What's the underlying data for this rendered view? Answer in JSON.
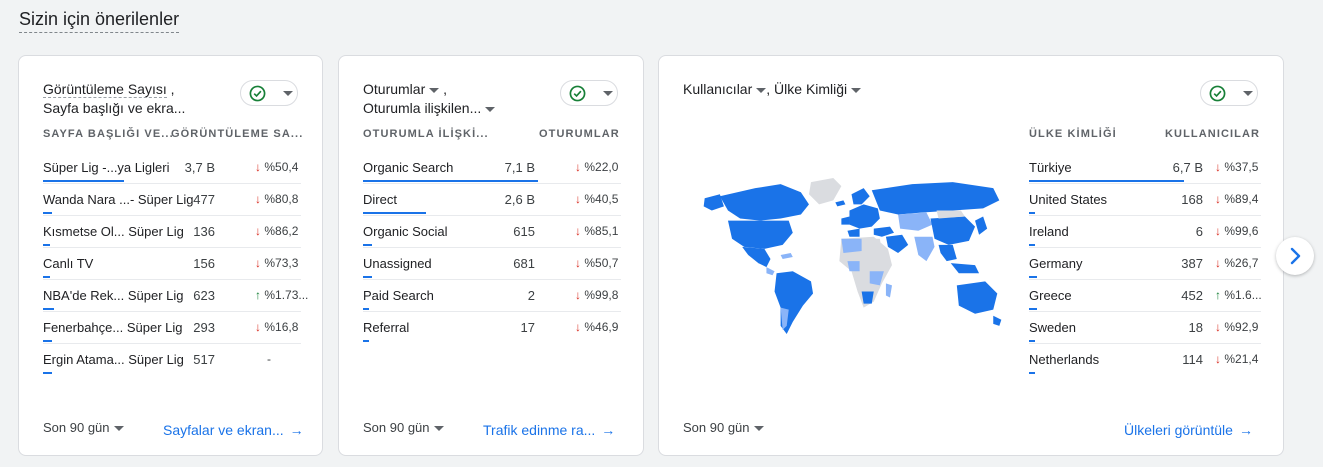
{
  "section_title": "Sizin için önerilenler",
  "colors": {
    "accent": "#1a73e8",
    "down": "#d93025",
    "up": "#188038",
    "ok": "#188038"
  },
  "cards": [
    {
      "title_line1": "Görüntüleme Sayısı",
      "title_line1_suffix": " ,",
      "title_line2": "Sayfa başlığı ve ekra...",
      "col1": "SAYFA BAŞLIĞI VE...",
      "col2": "GÖRÜNTÜLEME SA...",
      "rows": [
        {
          "label": "Süper Lig -...ya Ligleri",
          "value": "3,7 B",
          "dir": "down",
          "change": "%50,4",
          "share": 0.45
        },
        {
          "label": "Wanda Nara ...- Süper Lig",
          "value": "477",
          "dir": "down",
          "change": "%80,8",
          "share": 0.05
        },
        {
          "label": "Kısmetse Ol... Süper Lig",
          "value": "136",
          "dir": "down",
          "change": "%86,2",
          "share": 0.04
        },
        {
          "label": "Canlı TV",
          "value": "156",
          "dir": "down",
          "change": "%73,3",
          "share": 0.04
        },
        {
          "label": "NBA'de Rek... Süper Lig",
          "value": "623",
          "dir": "up",
          "change": "%1.73...",
          "share": 0.06
        },
        {
          "label": "Fenerbahçe... Süper Lig",
          "value": "293",
          "dir": "down",
          "change": "%16,8",
          "share": 0.05
        },
        {
          "label": "Ergin Atama... Süper Lig",
          "value": "517",
          "dir": "none",
          "change": "-",
          "share": 0.05
        }
      ],
      "period": "Son 90 gün",
      "link": "Sayfalar ve ekran..."
    },
    {
      "title_line1": "Oturumlar",
      "title_line1_suffix": " ,",
      "title_line2": "Oturumla ilişkilen...",
      "col1": "OTURUMLA İLİŞKİ...",
      "col2": "OTURUMLAR",
      "rows": [
        {
          "label": "Organic Search",
          "value": "7,1 B",
          "dir": "down",
          "change": "%22,0",
          "share": 0.97
        },
        {
          "label": "Direct",
          "value": "2,6 B",
          "dir": "down",
          "change": "%40,5",
          "share": 0.35
        },
        {
          "label": "Organic Social",
          "value": "615",
          "dir": "down",
          "change": "%85,1",
          "share": 0.05
        },
        {
          "label": "Unassigned",
          "value": "681",
          "dir": "down",
          "change": "%50,7",
          "share": 0.05
        },
        {
          "label": "Paid Search",
          "value": "2",
          "dir": "down",
          "change": "%99,8",
          "share": 0.02
        },
        {
          "label": "Referral",
          "value": "17",
          "dir": "down",
          "change": "%46,9",
          "share": 0.02
        }
      ],
      "period": "Son 90 gün",
      "link": "Trafik edinme ra..."
    },
    {
      "title_line1": "Kullanıcılar",
      "title_line1_suffix": ", Ülke Kimliği",
      "col1": "ÜLKE KİMLİĞİ",
      "col2": "KULLANICILAR",
      "rows": [
        {
          "label": "Türkiye",
          "value": "6,7 B",
          "dir": "down",
          "change": "%37,5",
          "share": 0.97
        },
        {
          "label": "United States",
          "value": "168",
          "dir": "down",
          "change": "%89,4",
          "share": 0.04
        },
        {
          "label": "Ireland",
          "value": "6",
          "dir": "down",
          "change": "%99,6",
          "share": 0.02
        },
        {
          "label": "Germany",
          "value": "387",
          "dir": "down",
          "change": "%26,7",
          "share": 0.05
        },
        {
          "label": "Greece",
          "value": "452",
          "dir": "up",
          "change": "%1.6...",
          "share": 0.05
        },
        {
          "label": "Sweden",
          "value": "18",
          "dir": "down",
          "change": "%92,9",
          "share": 0.02
        },
        {
          "label": "Netherlands",
          "value": "114",
          "dir": "down",
          "change": "%21,4",
          "share": 0.03
        }
      ],
      "period": "Son 90 gün",
      "link": "Ülkeleri görüntüle"
    }
  ]
}
